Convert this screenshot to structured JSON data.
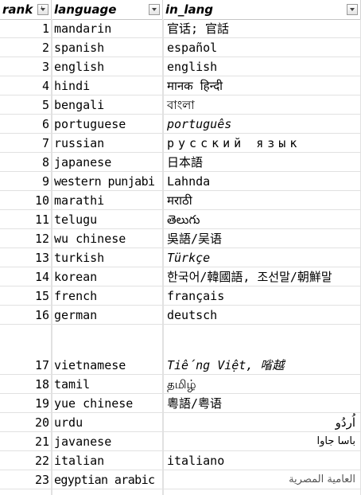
{
  "headers": {
    "rank": "rank",
    "language": "language",
    "in_lang": "in_lang"
  },
  "rows": [
    {
      "rank": "1",
      "language": "mandarin",
      "in_lang": "官话; 官話"
    },
    {
      "rank": "2",
      "language": "spanish",
      "in_lang": "español"
    },
    {
      "rank": "3",
      "language": "english",
      "in_lang": "english"
    },
    {
      "rank": "4",
      "language": "hindi",
      "in_lang": "मानक हिन्दी"
    },
    {
      "rank": "5",
      "language": "bengali",
      "in_lang": "বাংলা"
    },
    {
      "rank": "6",
      "language": "portuguese",
      "in_lang": "português"
    },
    {
      "rank": "7",
      "language": "russian",
      "in_lang": "русский язык"
    },
    {
      "rank": "8",
      "language": "japanese",
      "in_lang": "日本語"
    },
    {
      "rank": "9",
      "language": "western punjabi",
      "in_lang": "Lahnda"
    },
    {
      "rank": "10",
      "language": "marathi",
      "in_lang": "मराठी"
    },
    {
      "rank": "11",
      "language": "telugu",
      "in_lang": "తెలుగు"
    },
    {
      "rank": "12",
      "language": "wu chinese",
      "in_lang": "吳語/吴语"
    },
    {
      "rank": "13",
      "language": "turkish",
      "in_lang": "Türkçe"
    },
    {
      "rank": "14",
      "language": "korean",
      "in_lang": "한국어/韓國語, 조선말/朝鮮말"
    },
    {
      "rank": "15",
      "language": "french",
      "in_lang": "français"
    },
    {
      "rank": "16",
      "language": "german",
      "in_lang": "deutsch"
    },
    {
      "rank": "17",
      "language": "vietnamese",
      "in_lang": "Tiếng Việt, 㗂越"
    },
    {
      "rank": "18",
      "language": "tamil",
      "in_lang": "தமிழ்"
    },
    {
      "rank": "19",
      "language": "yue chinese",
      "in_lang": "粵語/粤语"
    },
    {
      "rank": "20",
      "language": "urdu",
      "in_lang": "اُردُو"
    },
    {
      "rank": "21",
      "language": "javanese",
      "in_lang": "باسا جاوا"
    },
    {
      "rank": "22",
      "language": "italian",
      "in_lang": "italiano"
    },
    {
      "rank": "23",
      "language": "egyptian arabic",
      "in_lang": "العامية المصرية"
    }
  ]
}
